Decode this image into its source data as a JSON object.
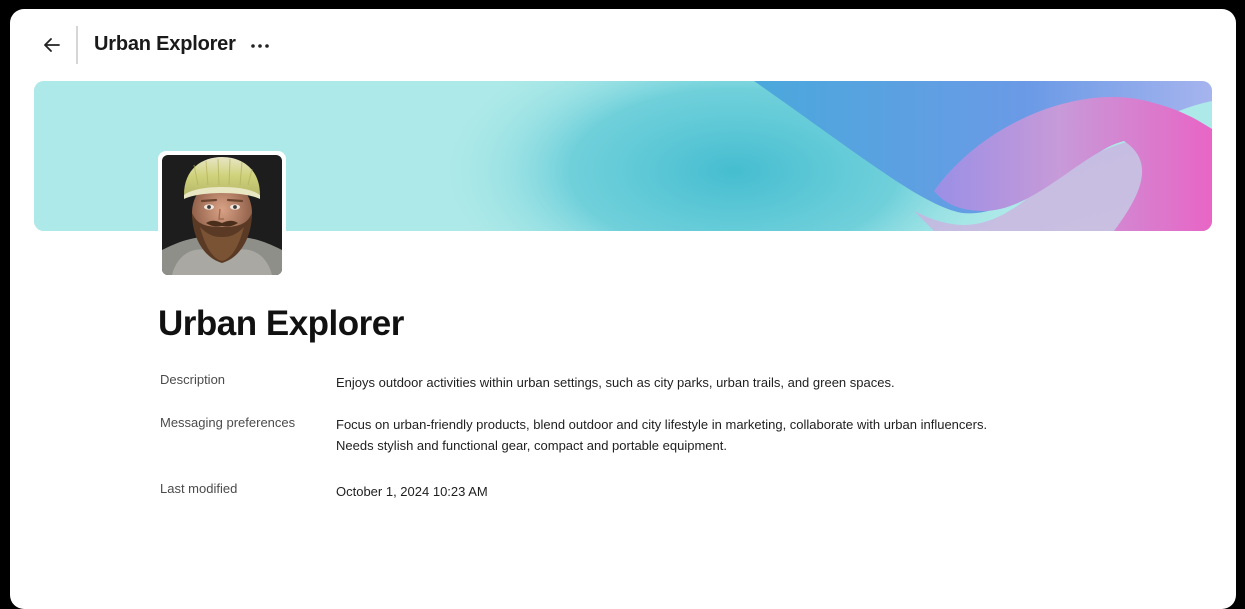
{
  "header": {
    "title": "Urban Explorer",
    "back_icon": "arrow-left-icon",
    "more_icon": "ellipsis-icon"
  },
  "profile": {
    "name": "Urban Explorer",
    "avatar": "bearded-man-in-knit-beanie-photo"
  },
  "details": {
    "description_label": "Description",
    "description_value": "Enjoys outdoor activities within urban settings, such as city parks, urban trails, and green spaces.",
    "messaging_label": "Messaging preferences",
    "messaging_line1": "Focus on urban-friendly products, blend outdoor and city lifestyle in marketing, collaborate with urban influencers.",
    "messaging_line2": "Needs stylish and functional gear, compact and portable equipment.",
    "modified_label": "Last modified",
    "modified_value": "October 1, 2024 10:23 AM"
  },
  "colors": {
    "banner_base": "#ade9e8",
    "banner_teal": "#4cc0d0",
    "banner_blue": "#5b9fe0",
    "banner_pink": "#e86cc8",
    "banner_purple": "#9a8be8"
  }
}
